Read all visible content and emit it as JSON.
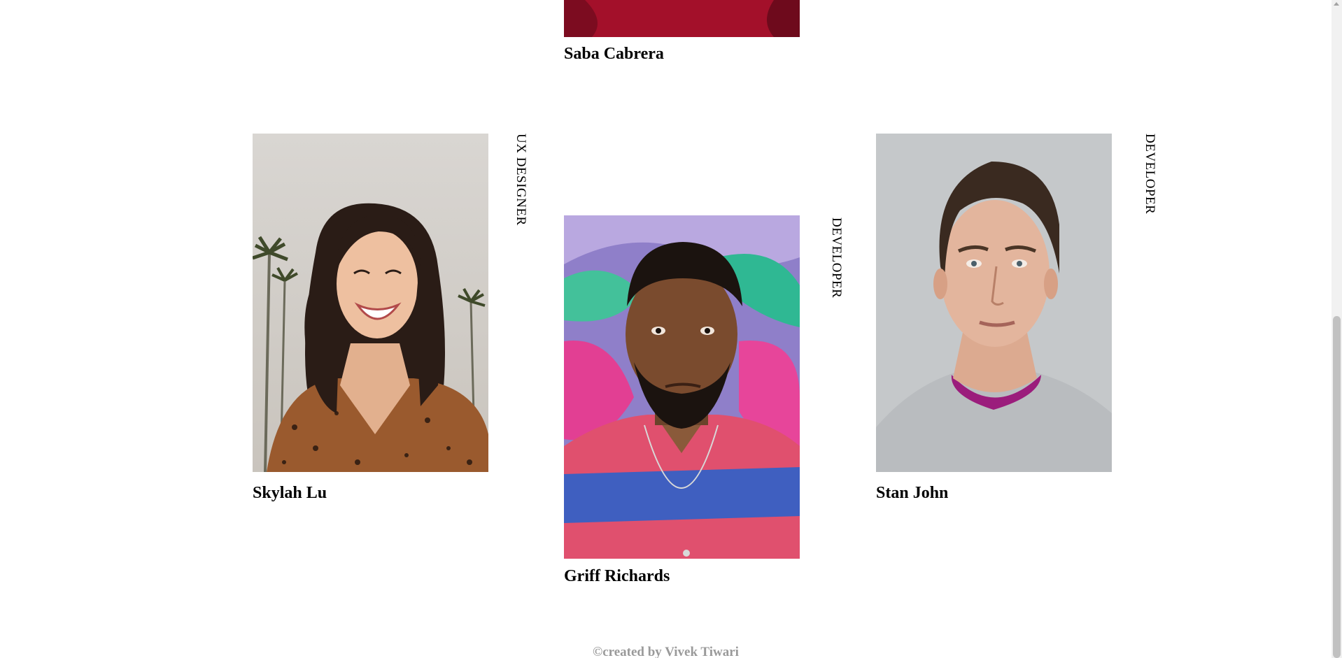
{
  "members": [
    {
      "name": "Saba Cabrera",
      "role": ""
    },
    {
      "name": "Skylah Lu",
      "role": "UX DESIGNER"
    },
    {
      "name": "Griff Richards",
      "role": "DEVELOPER"
    },
    {
      "name": "Stan John",
      "role": "DEVELOPER"
    }
  ],
  "footer": {
    "text": "©created by Vivek Tiwari"
  },
  "colors": {
    "footer_text": "#9a9a9a",
    "saba_shirt": "#a3102a"
  },
  "scrollbar": {
    "position_fraction": 1.0
  }
}
